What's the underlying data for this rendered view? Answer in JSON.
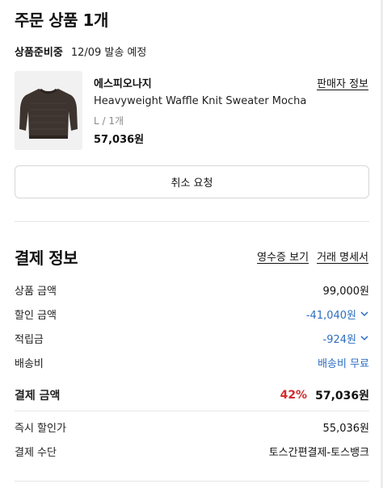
{
  "order": {
    "title": "주문 상품 1개",
    "status": "상품준비중",
    "ship_date": "12/09 발송 예정",
    "seller_link": "판매자 정보",
    "product": {
      "brand": "에스피오나지",
      "name": "Heavyweight Waffle Knit Sweater Mocha",
      "option": "L / 1개",
      "price": "57,036원"
    },
    "cancel_label": "취소 요청"
  },
  "payment": {
    "title": "결제 정보",
    "receipt_link": "영수증 보기",
    "statement_link": "거래 명세서",
    "rows": [
      {
        "label": "상품 금액",
        "value": "99,000원"
      },
      {
        "label": "할인 금액",
        "value": "-41,040원"
      },
      {
        "label": "적립금",
        "value": "-924원"
      },
      {
        "label": "배송비",
        "value": "배송비 무료"
      }
    ],
    "total": {
      "label": "결제 금액",
      "percent": "42%",
      "value": "57,036원"
    },
    "instant_discount": {
      "label": "즉시 할인가",
      "value": "55,036원"
    },
    "method": {
      "label": "결제 수단",
      "value": "토스간편결제-토스뱅크"
    }
  },
  "colors": {
    "link_blue": "#2d6ec0",
    "discount_red": "#d22c2c",
    "divider": "#e6e6e6"
  },
  "icons": [
    "chevron-down-icon",
    "sweater-image"
  ]
}
